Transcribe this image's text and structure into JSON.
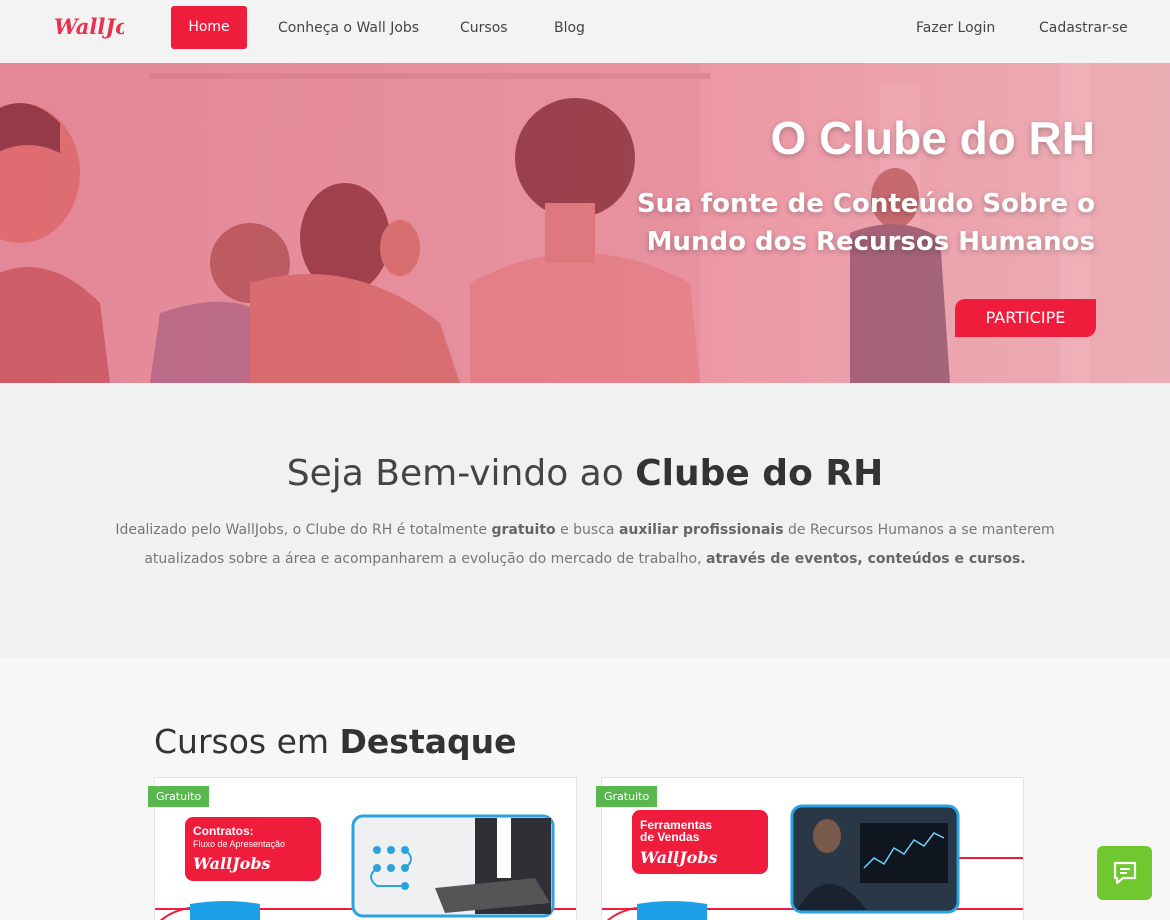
{
  "nav": {
    "logo_text": "WallJobs",
    "items": [
      {
        "label": "Home",
        "active": true
      },
      {
        "label": "Conheça o Wall Jobs"
      },
      {
        "label": "Cursos"
      },
      {
        "label": "Blog"
      }
    ],
    "login": "Fazer Login",
    "signup": "Cadastrar-se"
  },
  "hero": {
    "title": "O Clube do RH",
    "subtitle": "Sua fonte de Conteúdo Sobre o Mundo dos Recursos Humanos",
    "cta": "PARTICIPE"
  },
  "welcome": {
    "title_prefix": "Seja Bem-vindo ao ",
    "title_bold": "Clube do RH",
    "text_1": "Idealizado pelo WallJobs, o Clube do RH é totalmente ",
    "text_b1": "gratuito",
    "text_2": " e busca ",
    "text_b2": "auxiliar profissionais",
    "text_3": " de Recursos Humanos a se manterem atualizados sobre a área e acompanharem a evolução do mercado de trabalho, ",
    "text_b3": "através de eventos, conteúdos e cursos."
  },
  "courses": {
    "title_prefix": "Cursos em ",
    "title_bold": "Destaque",
    "cards": [
      {
        "badge": "Gratuito",
        "art_title": "Contratos:",
        "art_subtitle": "Fluxo de Apresentação",
        "art_brand": "WallJobs"
      },
      {
        "badge": "Gratuito",
        "art_title": "Ferramentas",
        "art_subtitle": "de Vendas",
        "art_brand": "WallJobs"
      }
    ]
  },
  "colors": {
    "accent": "#ef1c3c",
    "badge": "#59b84d",
    "chat": "#6fc92e"
  },
  "icons": {
    "chat": "chat-icon"
  }
}
